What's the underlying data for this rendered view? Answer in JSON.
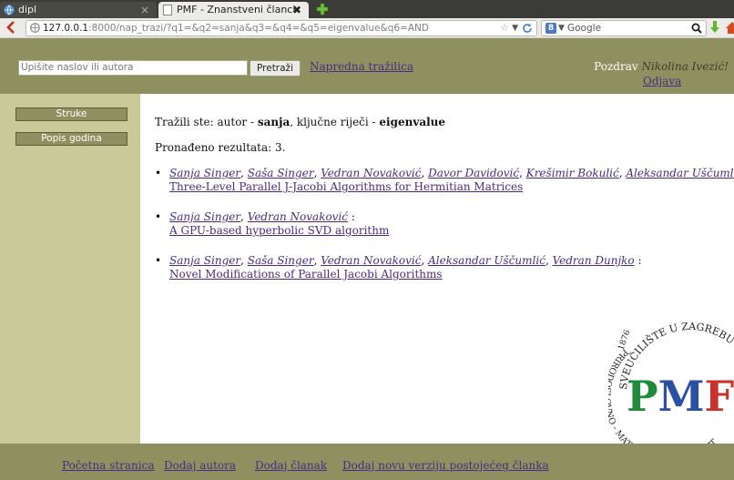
{
  "browser": {
    "tabs": [
      {
        "label": "dipl"
      },
      {
        "label": "PMF - Znanstveni članci"
      }
    ],
    "url_host": "127.0.0.1",
    "url_path": ":8000/nap_trazi/?q1=&q2=sanja&q3=&q4=&q5=eigenvalue&q6=AND",
    "search_engine": "Google"
  },
  "header": {
    "search_placeholder": "Upišite naslov ili autora",
    "search_button": "Pretraži",
    "advanced_link": "Napredna tražilica",
    "greeting": "Pozdrav",
    "user_name": "Nikolina Ivezić!",
    "logout": "Odjava"
  },
  "sidebar": {
    "items": [
      {
        "label": "Struke"
      },
      {
        "label": "Popis godina"
      }
    ]
  },
  "main": {
    "summary_prefix": "Tražili ste: autor - ",
    "summary_author": "sanja",
    "summary_mid": ", ključne riječi - ",
    "summary_keyword": "eigenvalue",
    "count_label": "Pronađeno rezultata: 3.",
    "results": [
      {
        "authors": [
          "Sanja Singer",
          "Saša Singer",
          "Vedran Novaković",
          "Davor Davidović",
          "Krešimir Bokulić",
          "Aleksandar Uščumlić"
        ],
        "title": "Three-Level Parallel J-Jacobi Algorithms for Hermitian Matrices"
      },
      {
        "authors": [
          "Sanja Singer",
          "Vedran Novaković"
        ],
        "title": "A GPU-based hyperbolic SVD algorithm"
      },
      {
        "authors": [
          "Sanja Singer",
          "Saša Singer",
          "Vedran Novaković",
          "Aleksandar Uščumlić",
          "Vedran Dunjko"
        ],
        "title": "Novel Modifications of Parallel Jacobi Algorithms"
      }
    ],
    "seal": {
      "top_text": "SVEUČILIŠTE U ZAGREBU",
      "left_text": "PRIRODOSLOVNO - MATEMATIČKI FAKULTET",
      "year": "1876",
      "monogram": "PMF"
    }
  },
  "footer": {
    "links": [
      {
        "label": "Početna stranica"
      },
      {
        "label": "Dodaj autora"
      },
      {
        "label": "Dodaj članak"
      },
      {
        "label": "Dodaj novu verziju postojećeg članka"
      }
    ]
  },
  "colors": {
    "header_bg": "#8f9060",
    "sidebar_bg": "#c9c999",
    "link": "#4b2a86",
    "seal_green": "#1f8a3a",
    "seal_blue": "#2a4fa3",
    "seal_red": "#c8332b"
  }
}
